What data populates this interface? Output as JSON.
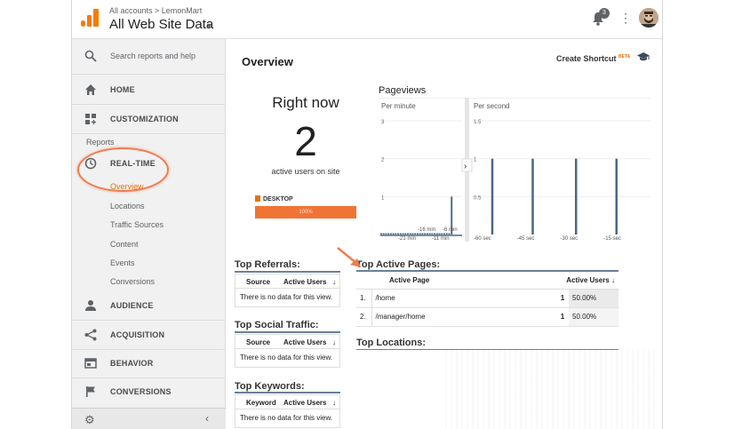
{
  "header": {
    "breadcrumb": "All accounts > LemonMart",
    "property_title": "All Web Site Data",
    "notification_count": "3"
  },
  "sidebar": {
    "search_placeholder": "Search reports and help",
    "home": "HOME",
    "customization": "CUSTOMIZATION",
    "reports_label": "Reports",
    "realtime": "REAL-TIME",
    "realtime_items": [
      "Overview",
      "Locations",
      "Traffic Sources",
      "Content",
      "Events",
      "Conversions"
    ],
    "audience": "AUDIENCE",
    "acquisition": "ACQUISITION",
    "behavior": "BEHAVIOR",
    "conversions": "CONVERSIONS"
  },
  "main": {
    "title": "Overview",
    "shortcut": "Create Shortcut",
    "shortcut_badge": "BETA",
    "right_now": {
      "title": "Right now",
      "count": "2",
      "subtitle": "active users on site",
      "device_label": "DESKTOP",
      "device_percent": "100%"
    },
    "pageviews": {
      "title": "Pageviews",
      "per_minute_label": "Per minute",
      "per_second_label": "Per second"
    },
    "top_referrals": {
      "title": "Top Referrals:",
      "col_source": "Source",
      "col_users": "Active Users",
      "empty": "There is no data for this view."
    },
    "top_social": {
      "title": "Top Social Traffic:",
      "col_source": "Source",
      "col_users": "Active Users",
      "empty": "There is no data for this view."
    },
    "top_keywords": {
      "title": "Top Keywords:",
      "col_keyword": "Keyword",
      "col_users": "Active Users",
      "empty": "There is no data for this view."
    },
    "top_pages": {
      "title": "Top Active Pages:",
      "col_page": "Active Page",
      "col_users": "Active Users",
      "rows": [
        {
          "idx": "1.",
          "page": "/home",
          "users": "1",
          "pct": "50.00%"
        },
        {
          "idx": "2.",
          "page": "/manager/home",
          "users": "1",
          "pct": "50.00%"
        }
      ]
    },
    "top_locations": {
      "title": "Top Locations:"
    }
  },
  "colors": {
    "accent": "#e8710a",
    "device_bar": "#f07434",
    "annotation": "#ef7c4f",
    "chart_bar": "#4a6785"
  },
  "chart_data": [
    {
      "type": "bar",
      "title": "Per minute",
      "x_tick_labels": [
        "-21 min",
        "-16 min",
        "-11 min",
        "-6 min"
      ],
      "y_tick_labels": [
        "1",
        "2",
        "3"
      ],
      "ylim": [
        0,
        3
      ],
      "values": [
        0,
        0,
        0,
        0,
        0,
        0,
        0,
        0,
        0,
        0,
        0,
        0,
        0,
        0,
        0,
        0,
        0,
        0,
        0,
        0,
        0,
        0,
        0,
        0,
        0,
        0,
        0,
        0,
        0,
        1
      ]
    },
    {
      "type": "bar",
      "title": "Per second",
      "x_tick_labels": [
        "-60 sec",
        "-45 sec",
        "-30 sec",
        "-15 sec"
      ],
      "y_tick_labels": [
        "0.5",
        "1",
        "1.5"
      ],
      "ylim": [
        0,
        1.5
      ],
      "bars": [
        {
          "x": -53,
          "value": 1
        },
        {
          "x": -39,
          "value": 1
        },
        {
          "x": -24,
          "value": 1
        },
        {
          "x": -10,
          "value": 1
        }
      ]
    }
  ]
}
